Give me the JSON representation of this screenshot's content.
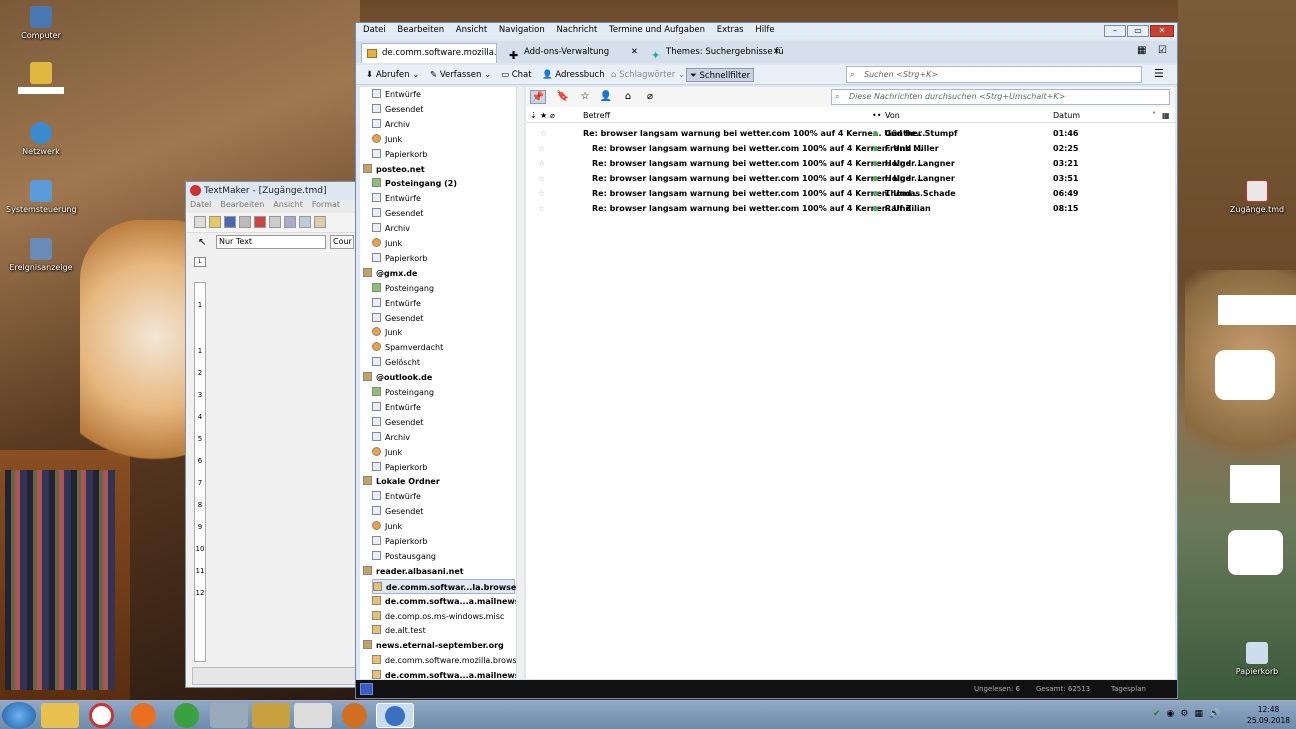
{
  "desktop": {
    "icons": [
      {
        "label": "Computer"
      },
      {
        "label": ""
      },
      {
        "label": "Netzwerk"
      },
      {
        "label": "Systemsteuerung"
      },
      {
        "label": "Ereignisanzeige"
      },
      {
        "label": "Zugänge.tmd"
      },
      {
        "label": "Papierkorb"
      }
    ]
  },
  "textmaker": {
    "title": "TextMaker - [Zugänge.tmd]",
    "menu": [
      "Datei",
      "Bearbeiten",
      "Ansicht",
      "Format"
    ],
    "style_select": "Nur Text",
    "font_select": "Cour",
    "ruler_marks": [
      "1",
      "1",
      "2",
      "3",
      "4",
      "5",
      "6",
      "7",
      "8",
      "9",
      "10",
      "11",
      "12"
    ]
  },
  "thunderbird": {
    "menu": [
      "Datei",
      "Bearbeiten",
      "Ansicht",
      "Navigation",
      "Nachricht",
      "Termine und Aufgaben",
      "Extras",
      "Hilfe"
    ],
    "tabs": [
      {
        "label": "de.comm.software.mozilla.brow"
      },
      {
        "label": "Add-ons-Verwaltung"
      },
      {
        "label": "Themes: Suchergebnisse für"
      }
    ],
    "toolbar": {
      "abrufen": "Abrufen",
      "verfassen": "Verfassen",
      "chat": "Chat",
      "adressbuch": "Adressbuch",
      "schlagwoerter": "Schlagwörter",
      "schnellfilter": "Schnellfilter",
      "search_placeholder": "Suchen <Strg+K>"
    },
    "folders": [
      {
        "label": "Entwürfe",
        "type": "folder"
      },
      {
        "label": "Gesendet",
        "type": "folder"
      },
      {
        "label": "Archiv",
        "type": "folder"
      },
      {
        "label": "Junk",
        "type": "junk"
      },
      {
        "label": "Papierkorb",
        "type": "folder"
      },
      {
        "label": "posteo.net",
        "type": "account"
      },
      {
        "label": "Posteingang (2)",
        "type": "inbox",
        "bold": true
      },
      {
        "label": "Entwürfe",
        "type": "folder"
      },
      {
        "label": "Gesendet",
        "type": "folder"
      },
      {
        "label": "Archiv",
        "type": "folder"
      },
      {
        "label": "Junk",
        "type": "junk"
      },
      {
        "label": "Papierkorb",
        "type": "folder"
      },
      {
        "label": "@gmx.de",
        "type": "account"
      },
      {
        "label": "Posteingang",
        "type": "inbox"
      },
      {
        "label": "Entwürfe",
        "type": "folder"
      },
      {
        "label": "Gesendet",
        "type": "folder"
      },
      {
        "label": "Junk",
        "type": "junk"
      },
      {
        "label": "Spamverdacht",
        "type": "junk"
      },
      {
        "label": "Gelöscht",
        "type": "folder"
      },
      {
        "label": "@outlook.de",
        "type": "account"
      },
      {
        "label": "Posteingang",
        "type": "inbox"
      },
      {
        "label": "Entwürfe",
        "type": "folder"
      },
      {
        "label": "Gesendet",
        "type": "folder"
      },
      {
        "label": "Archiv",
        "type": "folder"
      },
      {
        "label": "Junk",
        "type": "junk"
      },
      {
        "label": "Papierkorb",
        "type": "folder"
      },
      {
        "label": "Lokale Ordner",
        "type": "account"
      },
      {
        "label": "Entwürfe",
        "type": "folder"
      },
      {
        "label": "Gesendet",
        "type": "folder"
      },
      {
        "label": "Junk",
        "type": "junk"
      },
      {
        "label": "Papierkorb",
        "type": "folder"
      },
      {
        "label": "Postausgang",
        "type": "folder"
      },
      {
        "label": "reader.albasani.net",
        "type": "account"
      },
      {
        "label": "de.comm.softwar...la.browser (6)",
        "type": "news",
        "bold": true,
        "selected": true
      },
      {
        "label": "de.comm.softwa...a.mailnews (1)",
        "type": "news",
        "bold": true
      },
      {
        "label": "de.comp.os.ms-windows.misc",
        "type": "news"
      },
      {
        "label": "de.alt.test",
        "type": "news"
      },
      {
        "label": "news.eternal-september.org",
        "type": "account"
      },
      {
        "label": "de.comm.software.mozilla.browser",
        "type": "news"
      },
      {
        "label": "de.comm.softwa...a.mailnews (1)",
        "type": "news",
        "bold": true
      }
    ],
    "quickfilter_placeholder": "Diese Nachrichten durchsuchen <Strg+Umschalt+K>",
    "columns": {
      "betreff": "Betreff",
      "von": "Von",
      "datum": "Datum"
    },
    "messages": [
      {
        "subject": "Re: browser langsam warnung bei wetter.com 100% auf 4 Kernen. Und be...",
        "from": "Günther Stumpf",
        "date": "01:46"
      },
      {
        "subject": "Re: browser langsam warnung bei wetter.com 100% auf 4 Kernen. Und ...",
        "from": "Frank Miller",
        "date": "02:25"
      },
      {
        "subject": "Re: browser langsam warnung bei wetter.com 100% auf 4 Kernen. Und ...",
        "from": "Holger Langner",
        "date": "03:21"
      },
      {
        "subject": "Re: browser langsam warnung bei wetter.com 100% auf 4 Kernen. Und ...",
        "from": "Holger Langner",
        "date": "03:51"
      },
      {
        "subject": "Re: browser langsam warnung bei wetter.com 100% auf 4 Kernen. Und ...",
        "from": "Thomas Schade",
        "date": "06:49"
      },
      {
        "subject": "Re: browser langsam warnung bei wetter.com 100% auf 4 Kernen. Und ...",
        "from": "Ralf Zilian",
        "date": "08:15"
      }
    ],
    "status": {
      "ungelesen": "Ungelesen: 6",
      "gesamt": "Gesamt: 62513",
      "today": "Tagesplan"
    }
  },
  "taskbar": {
    "time": "12:48",
    "date": "25.09.2018"
  }
}
